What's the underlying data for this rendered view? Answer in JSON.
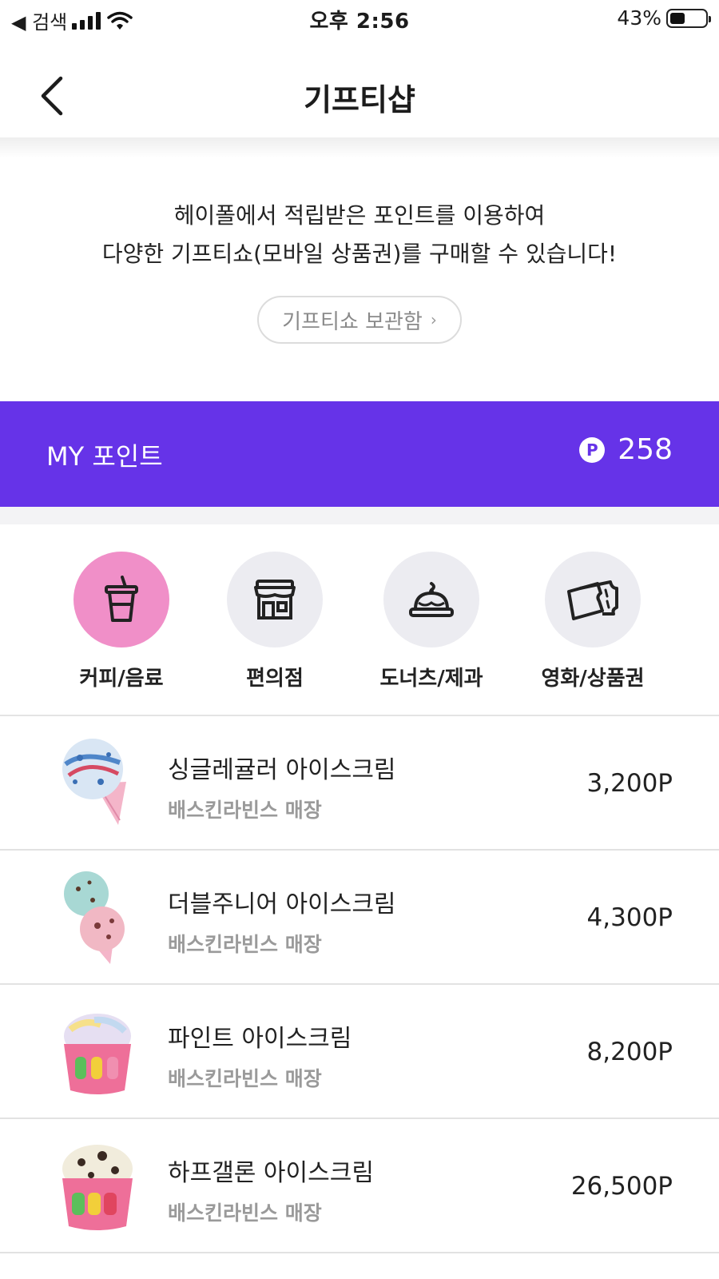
{
  "status_bar": {
    "back_app": "◀ 검색",
    "time": "오후 2:56",
    "battery": "43%"
  },
  "header": {
    "title": "기프티샵"
  },
  "intro": {
    "line1": "헤이폴에서 적립받은 포인트를 이용하여",
    "line2": "다양한 기프티쇼(모바일 상품권)를 구매할 수 있습니다!",
    "locker_button": "기프티쇼 보관함",
    "locker_chevron": "›"
  },
  "points": {
    "label": "MY 포인트",
    "coin": "P",
    "value": "258",
    "banner_color": "#6633e8"
  },
  "categories": [
    {
      "label": "커피/음료",
      "icon": "drink-cup-icon",
      "active": true
    },
    {
      "label": "편의점",
      "icon": "store-icon",
      "active": false
    },
    {
      "label": "도너츠/제과",
      "icon": "cake-icon",
      "active": false
    },
    {
      "label": "영화/상품권",
      "icon": "ticket-icon",
      "active": false
    }
  ],
  "products": [
    {
      "name": "싱글레귤러 아이스크림",
      "store": "배스킨라빈스 매장",
      "price": "3,200P",
      "image": "single-cone-image"
    },
    {
      "name": "더블주니어 아이스크림",
      "store": "배스킨라빈스 매장",
      "price": "4,300P",
      "image": "double-cone-image"
    },
    {
      "name": "파인트 아이스크림",
      "store": "배스킨라빈스 매장",
      "price": "8,200P",
      "image": "pint-cup-image"
    },
    {
      "name": "하프갤론 아이스크림",
      "store": "배스킨라빈스 매장",
      "price": "26,500P",
      "image": "half-gallon-cup-image"
    }
  ],
  "colors": {
    "accent": "#6633e8",
    "active_category": "#f08fc8",
    "inactive_category": "#ececf1"
  }
}
